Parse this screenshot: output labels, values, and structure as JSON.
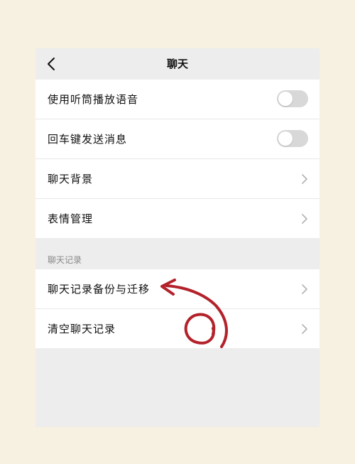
{
  "header": {
    "title": "聊天"
  },
  "settings": [
    {
      "label": "使用听筒播放语音",
      "control": "toggle",
      "state": "off"
    },
    {
      "label": "回车键发送消息",
      "control": "toggle",
      "state": "off"
    },
    {
      "label": "聊天背景",
      "control": "chevron"
    },
    {
      "label": "表情管理",
      "control": "chevron"
    }
  ],
  "chat_history_section": {
    "title": "聊天记录",
    "items": [
      {
        "label": "聊天记录备份与迁移",
        "control": "chevron"
      },
      {
        "label": "清空聊天记录",
        "control": "chevron"
      }
    ]
  },
  "colors": {
    "annotation": "#b3222b",
    "toggle_off": "#d8d8d8"
  },
  "icons": [
    "back-arrow-icon",
    "chevron-right-icon"
  ]
}
